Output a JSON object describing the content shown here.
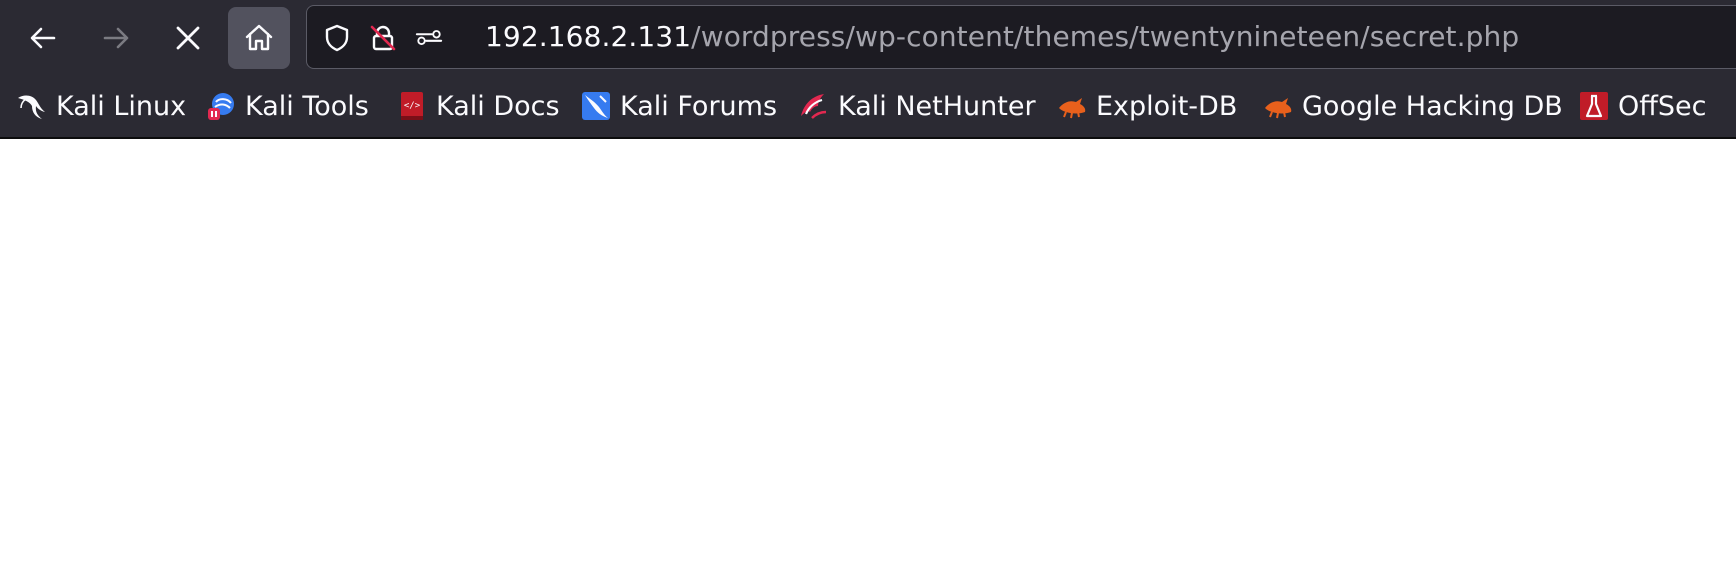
{
  "toolbar": {
    "back_icon": "arrow-left-icon",
    "forward_icon": "arrow-right-icon",
    "stop_icon": "close-icon",
    "home_icon": "home-icon"
  },
  "urlbar": {
    "host": "192.168.2.131",
    "path": "/wordpress/wp-content/themes/twentynineteen/secret.php",
    "shield_icon": "shield-icon",
    "insecure_icon": "insecure-lock-icon",
    "permissions_icon": "permissions-icon"
  },
  "bookmarks": [
    {
      "label": "Kali Linux",
      "icon": "kali-dragon-icon"
    },
    {
      "label": "Kali Tools",
      "icon": "kali-tools-icon"
    },
    {
      "label": "Kali Docs",
      "icon": "kali-docs-icon"
    },
    {
      "label": "Kali Forums",
      "icon": "kali-forums-icon"
    },
    {
      "label": "Kali NetHunter",
      "icon": "kali-nethunter-icon"
    },
    {
      "label": "Exploit-DB",
      "icon": "exploit-db-icon"
    },
    {
      "label": "Google Hacking DB",
      "icon": "ghdb-icon"
    },
    {
      "label": "OffSec",
      "icon": "offsec-icon"
    }
  ],
  "colors": {
    "chrome_bg": "#2b2a33",
    "urlbar_bg": "#1c1b22",
    "text": "#fbfbfe",
    "url_path": "#a5a5ad",
    "page_bg": "#ffffff"
  }
}
